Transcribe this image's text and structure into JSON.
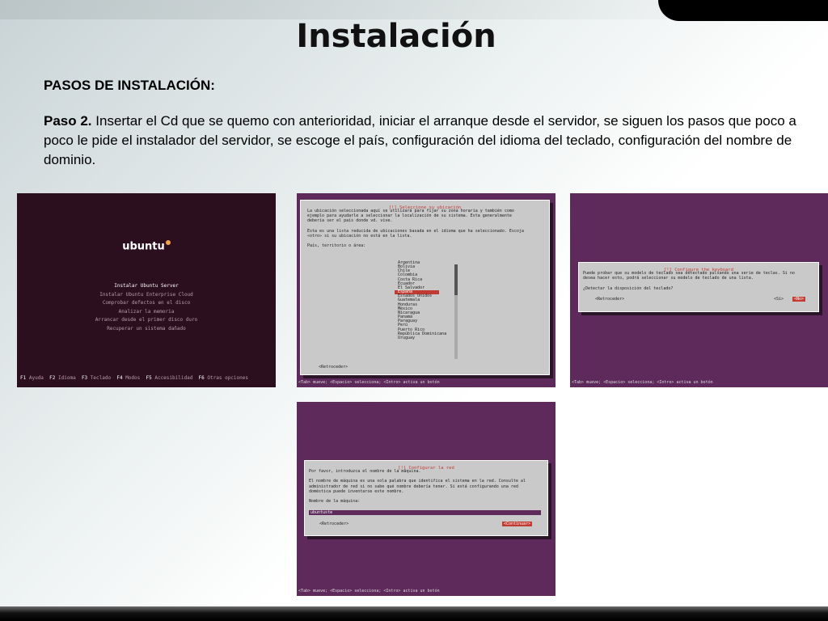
{
  "title": "Instalación",
  "section": "PASOS DE INSTALACIÓN:",
  "step": {
    "label": "Paso 2.",
    "text": " Insertar el Cd que se quemo con anterioridad, iniciar el arranque desde el servidor, se siguen los pasos que poco a poco le pide el instalador del servidor, se escoge el país, configuración del idioma del teclado, configuración del nombre de dominio."
  },
  "colors": {
    "ubuntu_purple": "#5e2a5b",
    "boot_bg": "#2c0f1e",
    "highlight_red": "#c23b33",
    "dialog_gray": "#c9c9c9"
  },
  "boot": {
    "logo": "ubuntu",
    "menu": [
      "Instalar Ubuntu Server",
      "Instalar Ubuntu Enterprise Cloud",
      "Comprobar defectos en el disco",
      "Analizar la memoria",
      "Arrancar desde el primer disco duro",
      "Recuperar un sistema dañado"
    ],
    "fkeys": [
      {
        "key": "F1",
        "label": "Ayuda"
      },
      {
        "key": "F2",
        "label": "Idioma"
      },
      {
        "key": "F3",
        "label": "Teclado"
      },
      {
        "key": "F4",
        "label": "Modos"
      },
      {
        "key": "F5",
        "label": "Accesibilidad"
      },
      {
        "key": "F6",
        "label": "Otras opciones"
      }
    ]
  },
  "location": {
    "title": "[!] Seleccione su ubicación",
    "intro": "La ubicación seleccionada aquí se utilizará para fijar su zona horaria y también como\nejemplo para ayudarle a seleccionar la localización de su sistema. Esta generalmente\ndebería ser el país donde vd. vive.\n\nEsta es una lista reducida de ubicaciones basada en el idioma que ha seleccionado. Escoja\n«otro» si su ubicación no está en la lista.\n\nPaís, territorio o área:",
    "countries": [
      "Argentina",
      "Bolivia",
      "Chile",
      "Colombia",
      "Costa Rica",
      "Ecuador",
      "El Salvador",
      "España",
      "Estados Unidos",
      "Guatemala",
      "Honduras",
      "México",
      "Nicaragua",
      "Panamá",
      "Paraguay",
      "Perú",
      "Puerto Rico",
      "República Dominicana",
      "Uruguay"
    ],
    "selected_index": 7,
    "back": "<Retroceder>",
    "status": "<Tab> mueve; <Espacio> selecciona; <Intro> activa un botón"
  },
  "keyboard": {
    "title": "[!] Configure the keyboard",
    "text": "Puede probar que su modelo de teclado sea detectado pulsando una serie de teclas. Si no\ndesea hacer esto, podrá seleccionar su modelo de teclado de una lista.\n\n¿Detectar la disposición del teclado?",
    "back": "<Retroceder>",
    "yes": "<Sí>",
    "no": "<No>",
    "status": "<Tab> mueve; <Espacio> selecciona; <Intro> activa un botón"
  },
  "network": {
    "title": "[!] Configurar la red",
    "text": "Por favor, introduzca el nombre de la máquina.\n\nEl nombre de máquina es una sola palabra que identifica el sistema en la red. Consulte al\nadministrador de red si no sabe qué nombre debería tener. Si está configurando una red\ndoméstica puede inventarse este nombre.\n\nNombre de la máquina:",
    "hostname": "ubuntuste",
    "back": "<Retroceder>",
    "continue": "<Continuar>",
    "status": "<Tab> mueve; <Espacio> selecciona; <Intro> activa un botón"
  }
}
